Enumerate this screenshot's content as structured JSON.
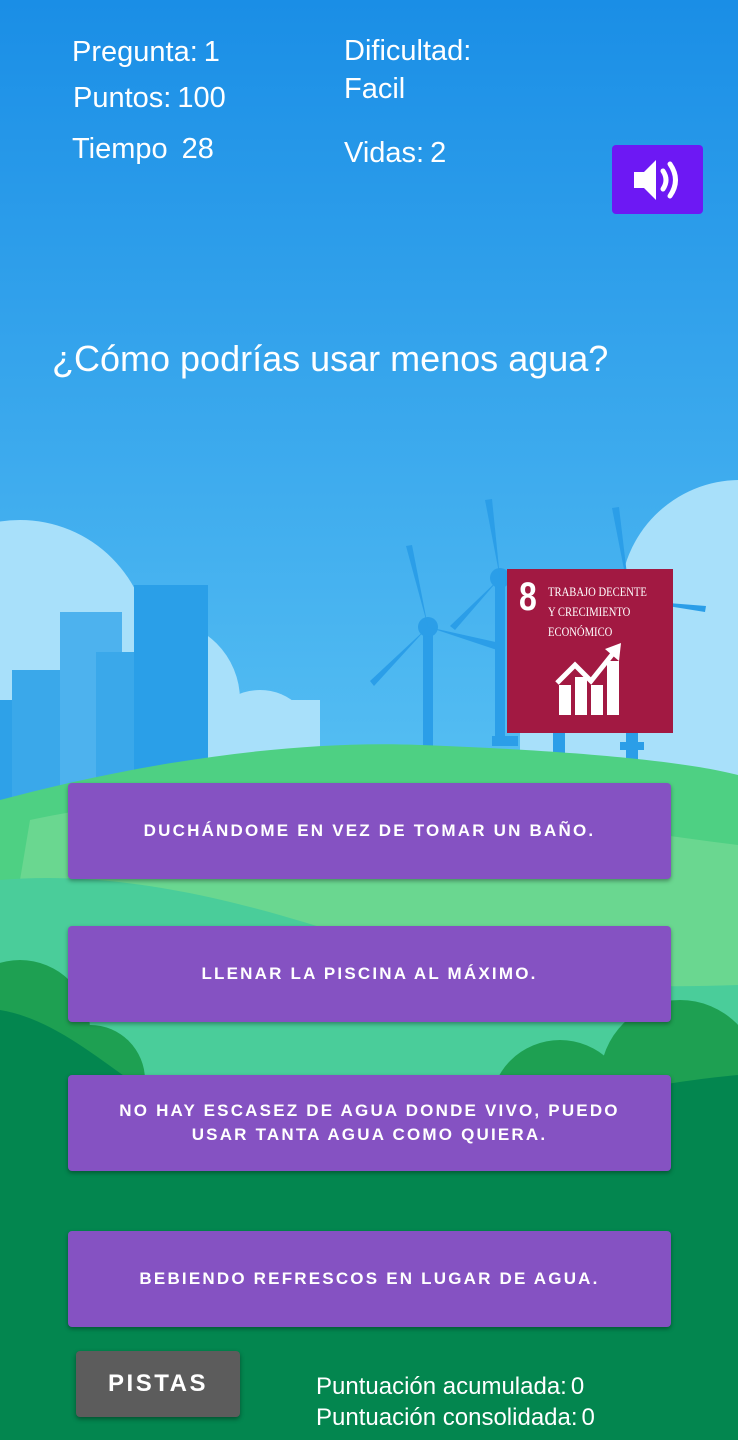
{
  "hud": {
    "question_label": "Pregunta:",
    "question_value": "1",
    "points_label": "Puntos:",
    "points_value": "100",
    "time_label": "Tiempo",
    "time_value": "28",
    "difficulty_label": "Dificultad:",
    "difficulty_value": "Facil",
    "lives_label": "Vidas:",
    "lives_value": "2"
  },
  "sound_icon": "speaker-volume-icon",
  "question": "¿Cómo podrías usar menos agua?",
  "sdg": {
    "number": "8",
    "title": "Trabajo decente y crecimiento económico",
    "color": "#a21942"
  },
  "answers": [
    "DUCHÁNDOME EN VEZ DE TOMAR UN BAÑO.",
    "LLENAR LA PISCINA AL MÁXIMO.",
    "NO HAY ESCASEZ DE AGUA DONDE VIVO, PUEDO USAR TANTA AGUA COMO QUIERA.",
    "BEBIENDO REFRESCOS EN LUGAR DE AGUA."
  ],
  "hints_button": "PISTAS",
  "scores": {
    "accumulated_label": "Puntuación acumulada:",
    "accumulated_value": "0",
    "consolidated_label": "Puntuación consolidada:",
    "consolidated_value": "0"
  },
  "colors": {
    "sky_top": "#1b8fe6",
    "sky_bottom": "#5cc3f4",
    "answer_button": "#8552c2",
    "sound_button": "#6d18f4",
    "hints_button": "#5c5c5c",
    "ground_dark": "#03864f"
  }
}
